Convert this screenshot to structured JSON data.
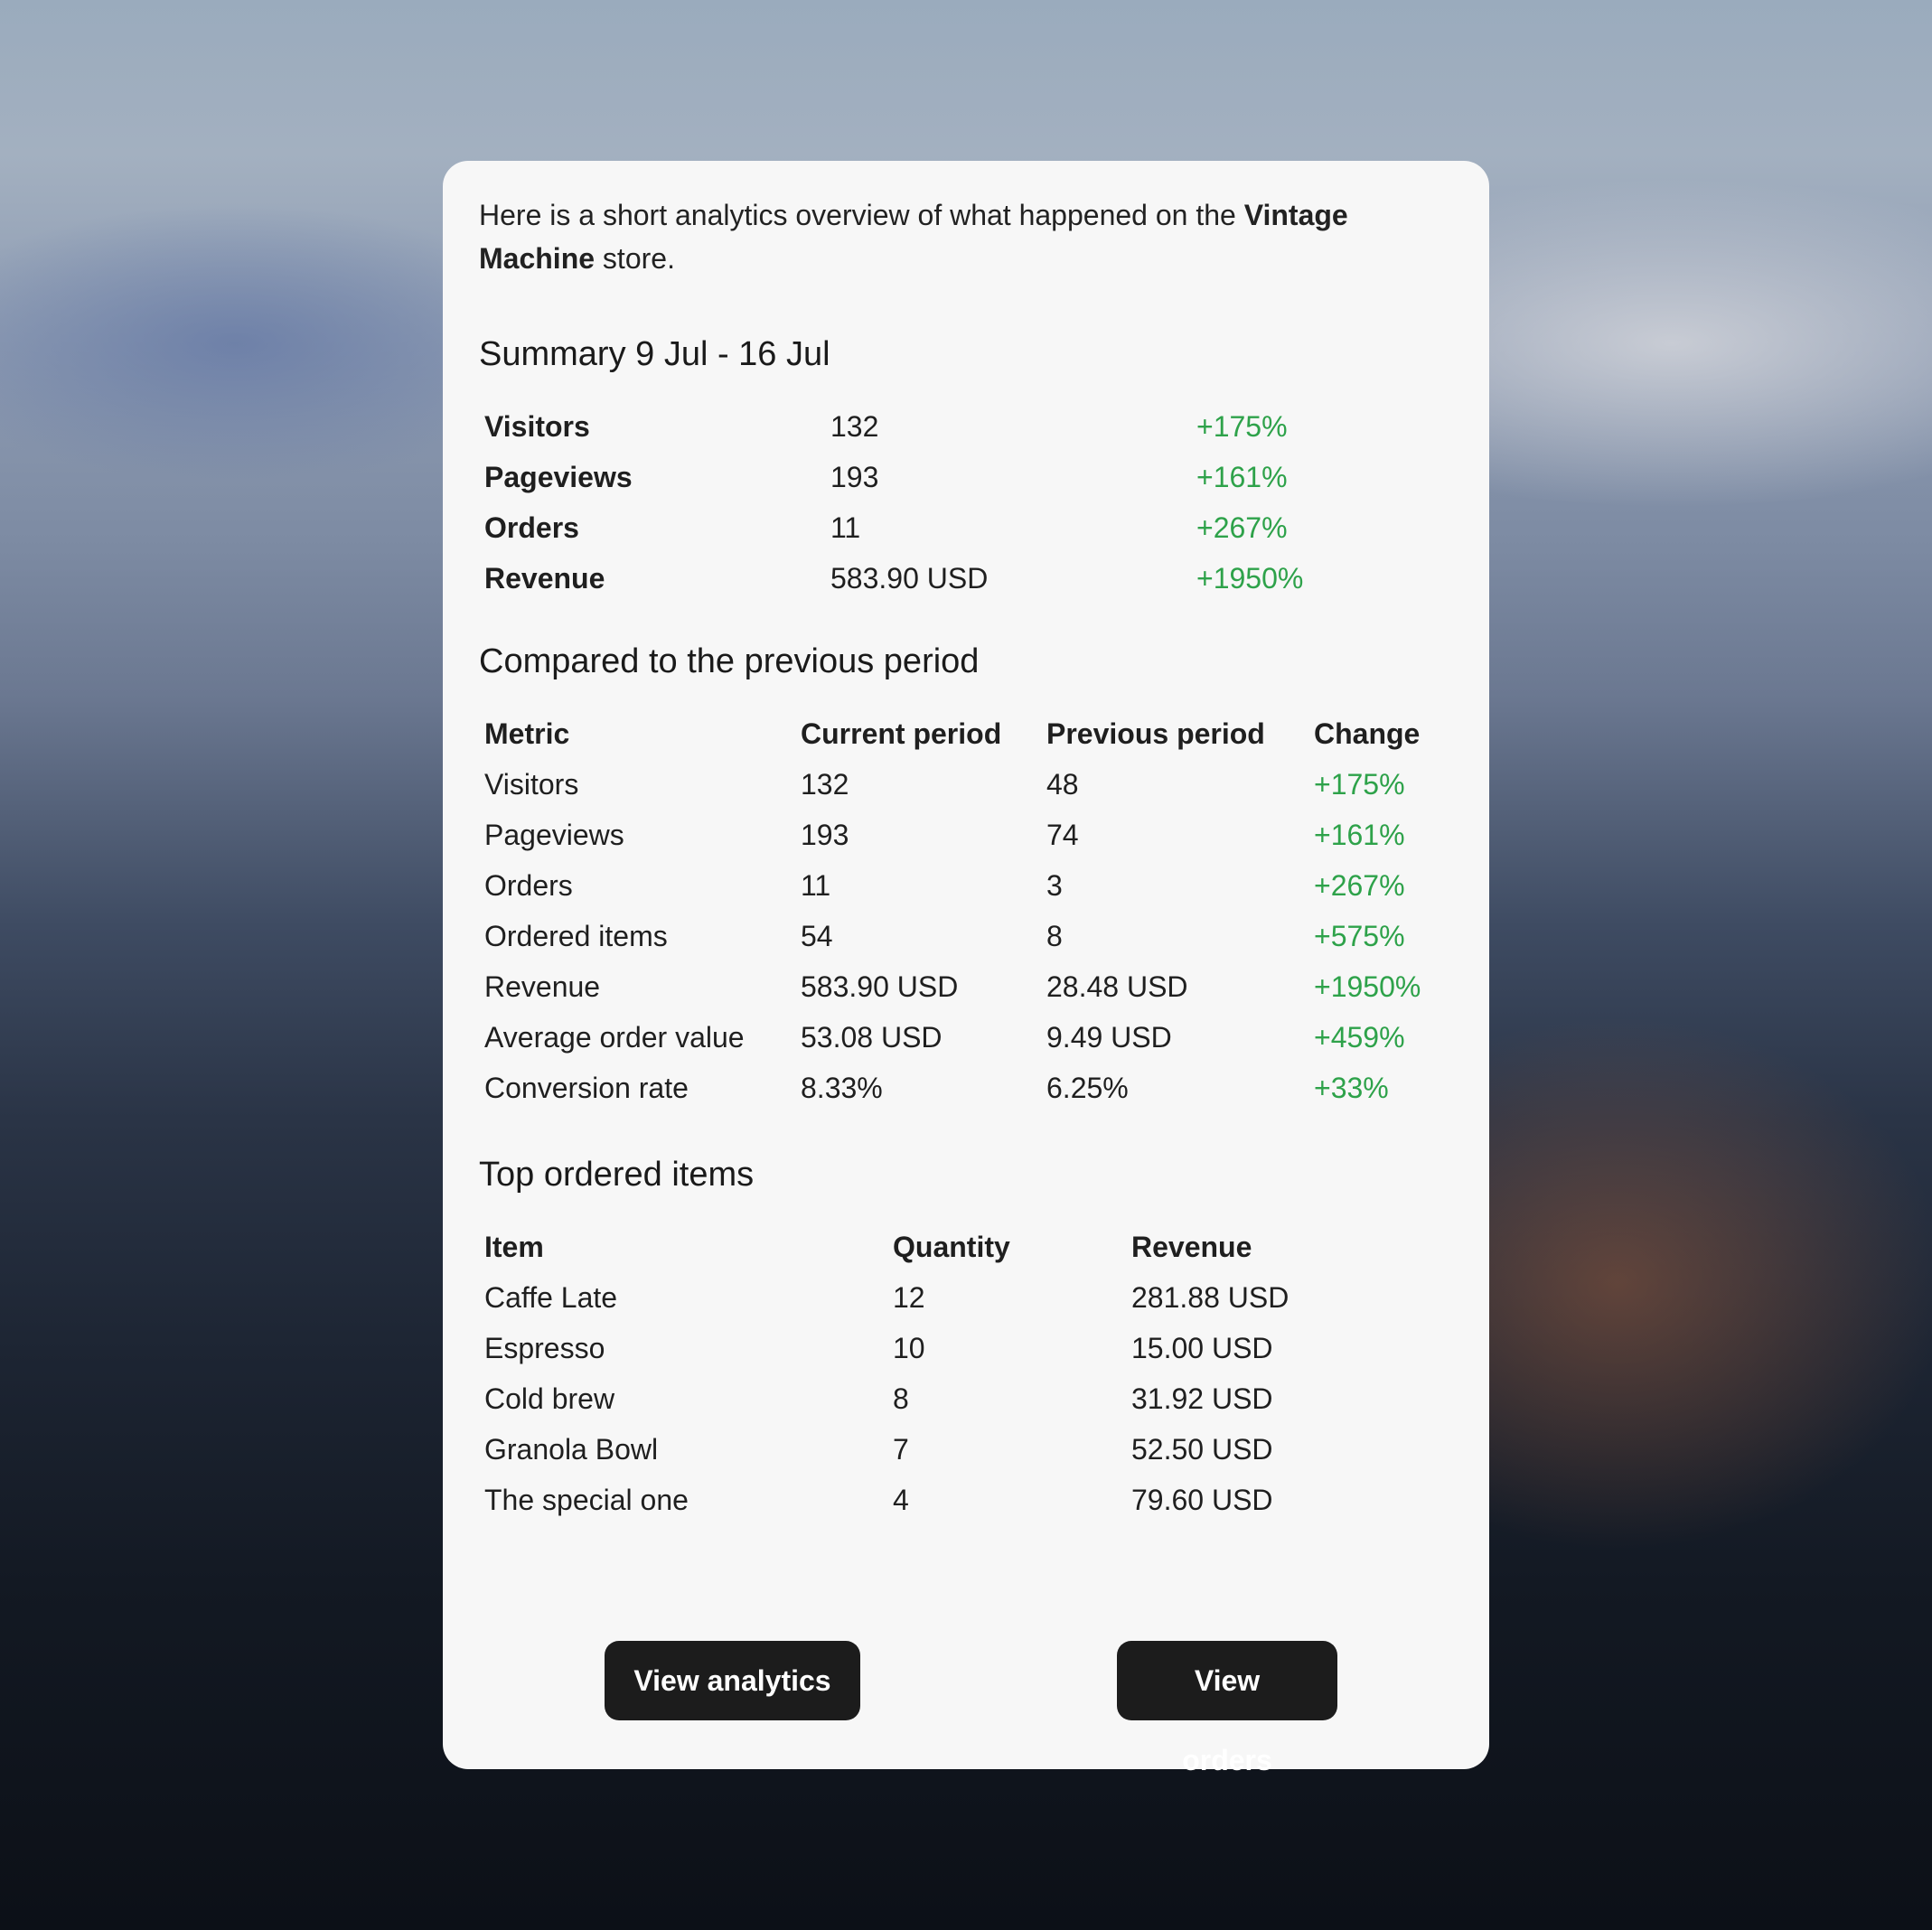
{
  "intro": {
    "prefix": "Here is a short analytics overview of what happened on the ",
    "store_name": "Vintage Machine",
    "suffix": " store."
  },
  "summary": {
    "title": "Summary 9 Jul - 16 Jul",
    "rows": [
      {
        "label": "Visitors",
        "value": "132",
        "change": "+175%"
      },
      {
        "label": "Pageviews",
        "value": "193",
        "change": "+161%"
      },
      {
        "label": "Orders",
        "value": "11",
        "change": "+267%"
      },
      {
        "label": "Revenue",
        "value": "583.90 USD",
        "change": "+1950%"
      }
    ]
  },
  "comparison": {
    "title": "Compared to the previous period",
    "headers": [
      "Metric",
      "Current period",
      "Previous period",
      "Change"
    ],
    "rows": [
      {
        "metric": "Visitors",
        "current": "132",
        "previous": "48",
        "change": "+175%"
      },
      {
        "metric": "Pageviews",
        "current": "193",
        "previous": "74",
        "change": "+161%"
      },
      {
        "metric": "Orders",
        "current": "11",
        "previous": "3",
        "change": "+267%"
      },
      {
        "metric": "Ordered items",
        "current": "54",
        "previous": "8",
        "change": "+575%"
      },
      {
        "metric": "Revenue",
        "current": "583.90 USD",
        "previous": "28.48 USD",
        "change": "+1950%"
      },
      {
        "metric": "Average order value",
        "current": "53.08 USD",
        "previous": "9.49 USD",
        "change": "+459%"
      },
      {
        "metric": "Conversion rate",
        "current": "8.33%",
        "previous": "6.25%",
        "change": "+33%"
      }
    ]
  },
  "top_items": {
    "title": "Top ordered items",
    "headers": [
      "Item",
      "Quantity",
      "Revenue"
    ],
    "rows": [
      {
        "item": "Caffe Late",
        "quantity": "12",
        "revenue": "281.88 USD"
      },
      {
        "item": "Espresso",
        "quantity": "10",
        "revenue": "15.00 USD"
      },
      {
        "item": "Cold brew",
        "quantity": "8",
        "revenue": "31.92 USD"
      },
      {
        "item": "Granola Bowl",
        "quantity": "7",
        "revenue": "52.50 USD"
      },
      {
        "item": "The special one",
        "quantity": "4",
        "revenue": "79.60 USD"
      }
    ]
  },
  "actions": {
    "view_analytics": "View analytics",
    "view_orders": "View orders"
  },
  "colors": {
    "positive_change": "#2ea24a",
    "button_bg": "#1c1c1c",
    "card_bg": "#f7f7f7"
  }
}
